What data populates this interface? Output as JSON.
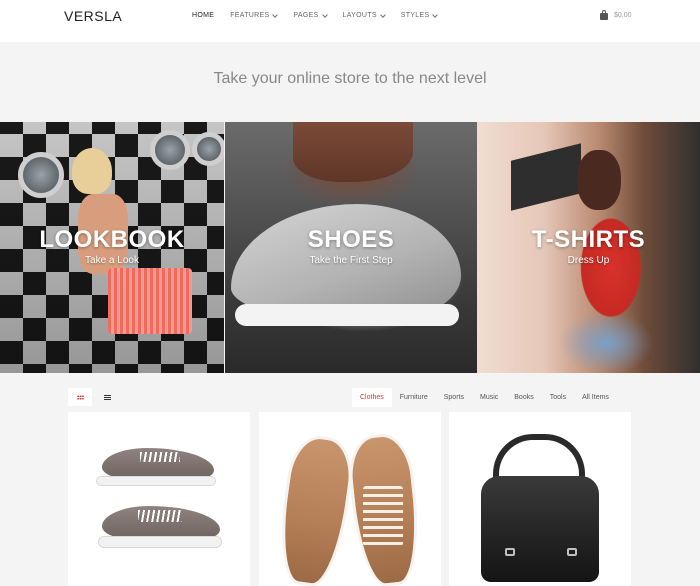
{
  "header": {
    "logo": "VERSLA",
    "nav": [
      {
        "label": "HOME",
        "dropdown": false
      },
      {
        "label": "FEATURES",
        "dropdown": true
      },
      {
        "label": "PAGES",
        "dropdown": true
      },
      {
        "label": "LAYOUTS",
        "dropdown": true
      },
      {
        "label": "STYLES",
        "dropdown": true
      }
    ],
    "cart_total": "$0.00",
    "cart_icon": "shopping-bag-icon"
  },
  "hero": {
    "tagline": "Take your online store to the next level"
  },
  "banners": [
    {
      "title": "LOOKBOOK",
      "subtitle": "Take a Look"
    },
    {
      "title": "SHOES",
      "subtitle": "Take the First Step"
    },
    {
      "title": "T-SHIRTS",
      "subtitle": "Dress Up"
    }
  ],
  "view_toggle": {
    "grid_icon": "grid-view-icon",
    "list_icon": "list-view-icon",
    "active": "grid"
  },
  "filters": {
    "items": [
      "Clothes",
      "Furniture",
      "Sports",
      "Music",
      "Books",
      "Tools",
      "All Items"
    ],
    "active": "Clothes"
  },
  "products": [
    {
      "image": "gray-sneakers"
    },
    {
      "image": "tan-sneakers"
    },
    {
      "image": "black-leather-bag"
    }
  ],
  "colors": {
    "accent": "#d8392f",
    "background": "#f4f4f4",
    "card": "#ffffff"
  }
}
